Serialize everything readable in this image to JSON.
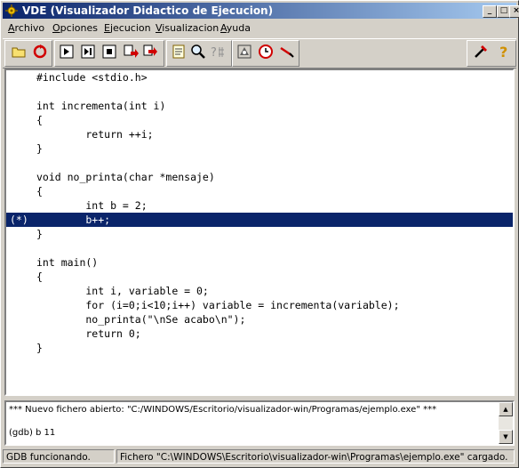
{
  "window": {
    "title": "VDE (Visualizador Didactico de Ejecucion)",
    "controls": {
      "minimize": "_",
      "maximize": "□",
      "close": "×"
    }
  },
  "menu": [
    {
      "label": "Archivo",
      "accel": "A"
    },
    {
      "label": "Opciones",
      "accel": "O"
    },
    {
      "label": "Ejecucion",
      "accel": "E"
    },
    {
      "label": "Visualizacion",
      "accel": "V"
    },
    {
      "label": "Ayuda",
      "accel": "A"
    }
  ],
  "toolbar": {
    "buttons": [
      {
        "name": "open-folder-icon"
      },
      {
        "name": "restart-icon"
      },
      {
        "name": "run-icon"
      },
      {
        "name": "step-icon"
      },
      {
        "name": "stop-icon"
      },
      {
        "name": "step-into-icon"
      },
      {
        "name": "step-out-icon"
      },
      {
        "name": "watch-icon"
      },
      {
        "name": "search-icon"
      },
      {
        "name": "eval-icon"
      },
      {
        "name": "breakpoint-icon"
      },
      {
        "name": "clock-icon"
      },
      {
        "name": "memory-icon"
      },
      {
        "name": "tools-icon"
      },
      {
        "name": "help-icon"
      }
    ]
  },
  "source": {
    "current_line_index": 10,
    "lines": [
      {
        "marker": "",
        "text": "#include <stdio.h>"
      },
      {
        "marker": "",
        "text": ""
      },
      {
        "marker": "",
        "text": "int incrementa(int i)"
      },
      {
        "marker": "",
        "text": "{"
      },
      {
        "marker": "",
        "text": "        return ++i;"
      },
      {
        "marker": "",
        "text": "}"
      },
      {
        "marker": "",
        "text": ""
      },
      {
        "marker": "",
        "text": "void no_printa(char *mensaje)"
      },
      {
        "marker": "",
        "text": "{"
      },
      {
        "marker": "",
        "text": "        int b = 2;"
      },
      {
        "marker": "(*)",
        "text": "        b++;"
      },
      {
        "marker": "",
        "text": "}"
      },
      {
        "marker": "",
        "text": ""
      },
      {
        "marker": "",
        "text": "int main()"
      },
      {
        "marker": "",
        "text": "{"
      },
      {
        "marker": "",
        "text": "        int i, variable = 0;"
      },
      {
        "marker": "",
        "text": "        for (i=0;i<10;i++) variable = incrementa(variable);"
      },
      {
        "marker": "",
        "text": "        no_printa(\"\\nSe acabo\\n\");"
      },
      {
        "marker": "",
        "text": "        return 0;"
      },
      {
        "marker": "",
        "text": "}"
      }
    ]
  },
  "console": {
    "lines": [
      "*** Nuevo fichero abierto: \"C:/WINDOWS/Escritorio/visualizador-win/Programas/ejemplo.exe\" ***",
      "(gdb) b 11"
    ]
  },
  "status": {
    "left": "GDB funcionando.",
    "right": "Fichero \"C:\\WINDOWS\\Escritorio\\visualizador-win\\Programas\\ejemplo.exe\" cargado."
  }
}
